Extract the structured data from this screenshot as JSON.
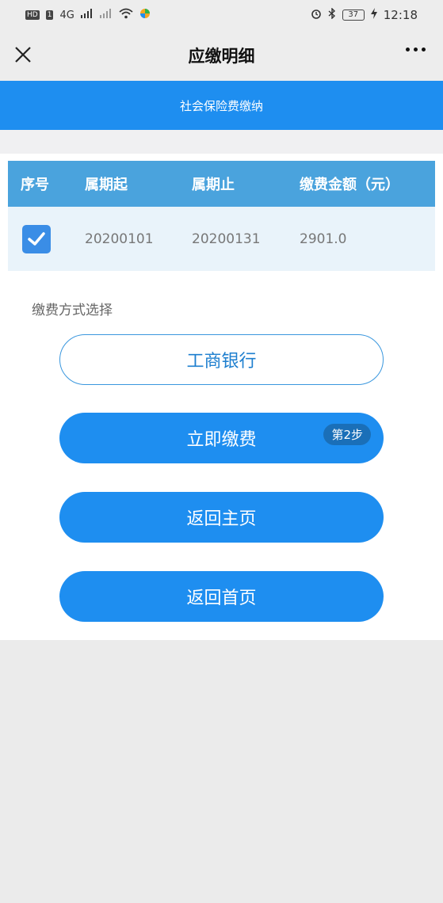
{
  "status_bar": {
    "left_badge": "HD",
    "left_badge2": "1",
    "network": "4G",
    "time": "12:18",
    "battery": "37"
  },
  "navbar": {
    "title": "应缴明细"
  },
  "banner": {
    "text": "社会保险费缴纳"
  },
  "table": {
    "headers": [
      "序号",
      "属期起",
      "属期止",
      "缴费金额（元）"
    ],
    "rows": [
      {
        "checked": true,
        "start": "20200101",
        "end": "20200131",
        "amount": "2901.0"
      }
    ]
  },
  "payment": {
    "section_label": "缴费方式选择",
    "bank_button": "工商银行",
    "pay_button": "立即缴费",
    "step_badge": "第2步",
    "back_main_button": "返回主页",
    "back_home_button": "返回首页"
  },
  "colors": {
    "primary": "#1e8ef0",
    "table_header": "#4aa3dd",
    "row_bg": "#e9f3fa",
    "checkbox": "#3a8de6"
  }
}
